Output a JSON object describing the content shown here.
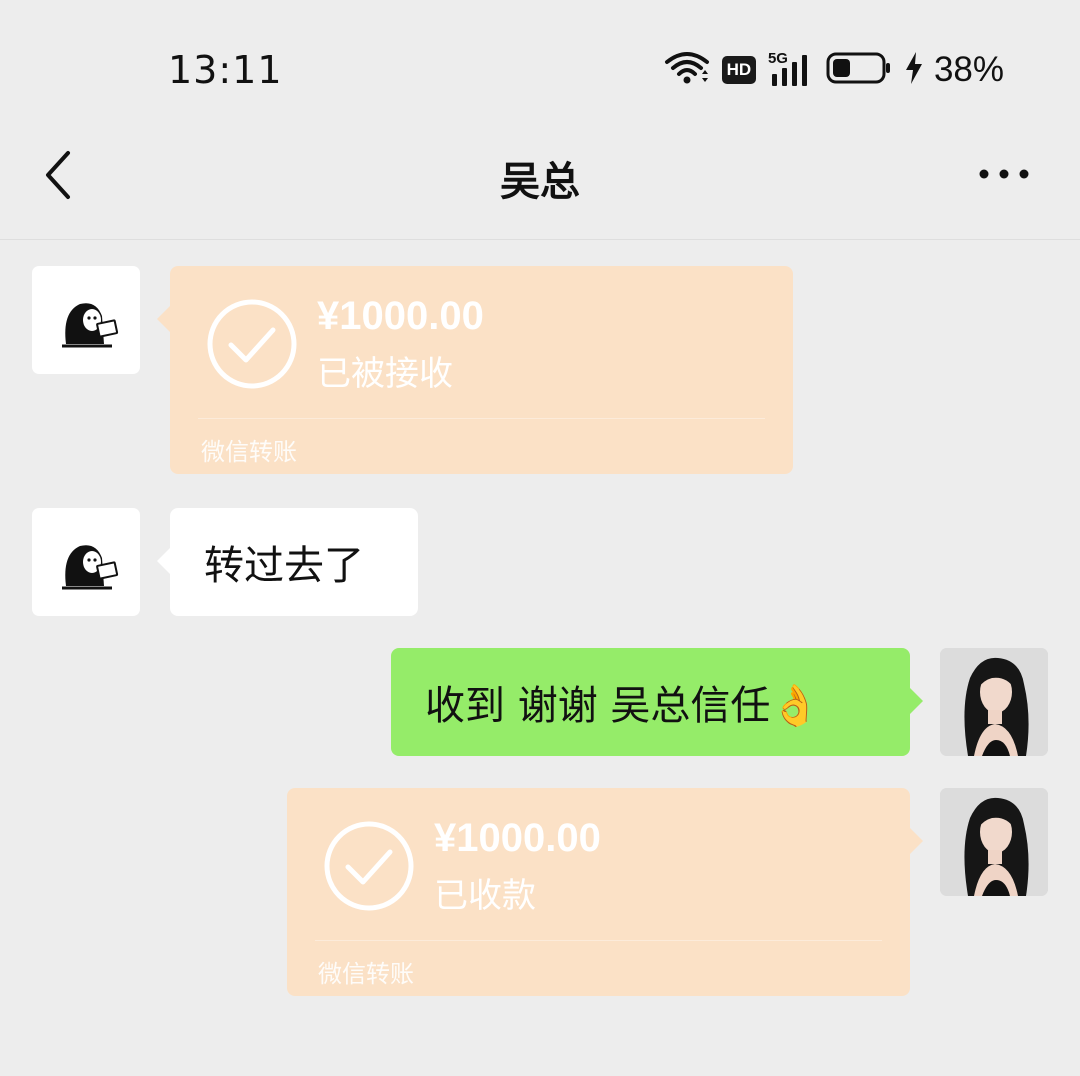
{
  "status_bar": {
    "time": "13:11",
    "hd_label": "HD",
    "network_label": "5G",
    "battery_percent": "38%",
    "battery_level": 0.38,
    "charging": true
  },
  "header": {
    "title": "吴总",
    "back_icon": "chevron-left-icon",
    "more_icon": "more-horizontal-icon"
  },
  "messages": [
    {
      "side": "left",
      "type": "transfer",
      "amount": "¥1000.00",
      "status": "已被接收",
      "footer": "微信转账"
    },
    {
      "side": "left",
      "type": "text",
      "text": "转过去了"
    },
    {
      "side": "right",
      "type": "text",
      "text": "收到  谢谢 吴总信任👌"
    },
    {
      "side": "right",
      "type": "transfer",
      "amount": "¥1000.00",
      "status": "已收款",
      "footer": "微信转账"
    }
  ],
  "colors": {
    "background": "#ededed",
    "transfer_card": "#fbe1c6",
    "sent_bubble": "#95ec69",
    "received_bubble": "#ffffff"
  }
}
